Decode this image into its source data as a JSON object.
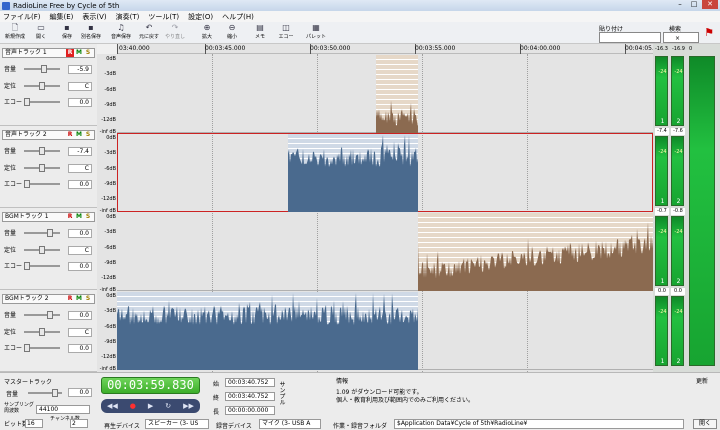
{
  "app": {
    "title": "RadioLine Free by Cycle of 5th"
  },
  "menu": [
    "ファイル(F)",
    "編集(E)",
    "表示(V)",
    "演奏(T)",
    "ツール(T)",
    "設定(O)",
    "ヘルプ(H)"
  ],
  "toolbar": [
    {
      "label": "新規作成",
      "icon": "new-file-icon",
      "disabled": false
    },
    {
      "label": "開く",
      "icon": "open-folder-icon",
      "disabled": false
    },
    {
      "label": "保存",
      "icon": "save-icon",
      "disabled": false
    },
    {
      "label": "別名保存",
      "icon": "save-as-icon",
      "disabled": false
    },
    {
      "label": "音声保存",
      "icon": "audio-save-icon",
      "disabled": false
    },
    {
      "label": "元に戻す",
      "icon": "undo-icon",
      "disabled": false
    },
    {
      "label": "やり直し",
      "icon": "redo-icon",
      "disabled": true
    },
    {
      "label": "拡大",
      "icon": "zoom-in-icon",
      "disabled": false
    },
    {
      "label": "縮小",
      "icon": "zoom-out-icon",
      "disabled": false
    },
    {
      "label": "メモ",
      "icon": "memo-icon",
      "disabled": false
    },
    {
      "label": "エコー",
      "icon": "echo-icon",
      "disabled": false
    },
    {
      "label": "パレット",
      "icon": "palette-icon",
      "disabled": false
    }
  ],
  "label_box": {
    "label": "貼り付け"
  },
  "search_box": {
    "label": "検索"
  },
  "tracks": [
    {
      "name": "音声トラック 1",
      "rec": true,
      "volume": "-5.9",
      "pan": "C",
      "echo": "0.0",
      "vol_level": 0.55,
      "pan_level": 0.5,
      "echo_level": 0.0
    },
    {
      "name": "音声トラック 2",
      "rec": false,
      "volume": "-7.4",
      "pan": "C",
      "echo": "0.0",
      "vol_level": 0.5,
      "pan_level": 0.5,
      "echo_level": 0.0
    },
    {
      "name": "BGMトラック 1",
      "rec": false,
      "volume": "0.0",
      "pan": "C",
      "echo": "0.0",
      "vol_level": 0.75,
      "pan_level": 0.5,
      "echo_level": 0.0
    },
    {
      "name": "BGMトラック 2",
      "rec": false,
      "volume": "0.0",
      "pan": "C",
      "echo": "0.0",
      "vol_level": 0.75,
      "pan_level": 0.5,
      "echo_level": 0.0
    }
  ],
  "track_labels": {
    "volume": "音量",
    "pan": "定位",
    "echo": "エコー",
    "R": "R",
    "M": "M",
    "S": "S"
  },
  "ruler": [
    "03:40.000",
    "00:03:45.000",
    "00:03:50.000",
    "00:03:55.000",
    "00:04:00.000",
    "00:04:05.000"
  ],
  "db_scale": [
    "0dB",
    "-3dB",
    "-6dB",
    "-9dB",
    "-12dB",
    "-inf dB"
  ],
  "meters": {
    "header": [
      "-16.3",
      "-16.9",
      "0"
    ],
    "tracks": [
      {
        "left": "-7.4",
        "right": "-7.6"
      },
      {
        "left": "-0.7",
        "right": "-0.8"
      },
      {
        "left": "0.0",
        "right": "0.0"
      }
    ],
    "channel_labels": [
      "1",
      "2"
    ],
    "meter_top_labels": [
      "-24",
      "-24"
    ]
  },
  "master": {
    "label": "マスタートラック",
    "volume_label": "音量",
    "volume": "0.0"
  },
  "sampling": {
    "label": "サンプリング周波数",
    "value": "44100"
  },
  "bit": {
    "label": "ビット数",
    "value": "16"
  },
  "channel": {
    "label": "チャンネル数",
    "value": "2"
  },
  "clock": "00:03:59.830",
  "times": {
    "start_label": "始",
    "start": "00:03:40.752",
    "end_label": "終",
    "end": "00:03:40.752",
    "length_label": "長",
    "length": "00:00:00.000",
    "sample_label": "サンプル"
  },
  "info": {
    "label": "情報",
    "lines": [
      "1.09 がダウンロード可能です。",
      "個人・教育利用及び範囲内でのみご利用ください。"
    ]
  },
  "update_label": "更新",
  "devices": {
    "play_label": "再生デバイス",
    "play_value": "スピーカー (3- US",
    "rec_label": "録音デバイス",
    "rec_value": "マイク (3- USB A",
    "folder_label": "作業・録音フォルダ",
    "folder_value": "$Application Data¥Cycle of 5th¥RadioLine¥",
    "open_label": "開く"
  },
  "colors": {
    "voice_clip": "#4a6a8e",
    "bgm_clip": "#8b6a50",
    "selection": "#cc2222",
    "clock": "#3cae2a"
  }
}
